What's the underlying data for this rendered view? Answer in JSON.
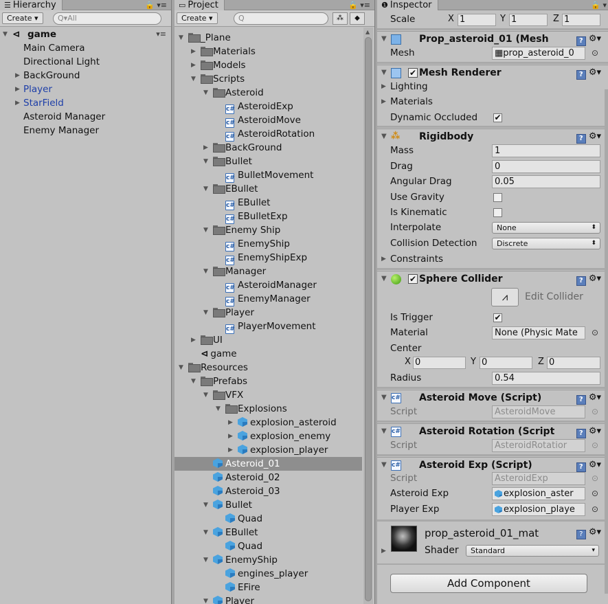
{
  "hierarchy": {
    "tab_label": "Hierarchy",
    "create_label": "Create",
    "search_placeholder": "All",
    "scene_name": "game",
    "items": [
      "Main Camera",
      "Directional Light",
      "BackGround",
      "Player",
      "StarField",
      "Asteroid Manager",
      "Enemy Manager"
    ]
  },
  "project": {
    "tab_label": "Project",
    "create_label": "Create",
    "tree": [
      {
        "label": "_Plane",
        "type": "folder",
        "arrow": "open"
      },
      {
        "label": "Materials",
        "type": "folder",
        "arrow": "closed"
      },
      {
        "label": "Models",
        "type": "folder",
        "arrow": "closed"
      },
      {
        "label": "Scripts",
        "type": "folder",
        "arrow": "open"
      },
      {
        "label": "Asteroid",
        "type": "folder",
        "arrow": "open"
      },
      {
        "label": "AsteroidExp",
        "type": "script"
      },
      {
        "label": "AsteroidMove",
        "type": "script"
      },
      {
        "label": "AsteroidRotation",
        "type": "script"
      },
      {
        "label": "BackGround",
        "type": "folder",
        "arrow": "closed"
      },
      {
        "label": "Bullet",
        "type": "folder",
        "arrow": "open"
      },
      {
        "label": "BulletMovement",
        "type": "script"
      },
      {
        "label": "EBullet",
        "type": "folder",
        "arrow": "open"
      },
      {
        "label": "EBullet",
        "type": "script"
      },
      {
        "label": "EBulletExp",
        "type": "script"
      },
      {
        "label": "Enemy Ship",
        "type": "folder",
        "arrow": "open"
      },
      {
        "label": "EnemyShip",
        "type": "script"
      },
      {
        "label": "EnemyShipExp",
        "type": "script"
      },
      {
        "label": "Manager",
        "type": "folder",
        "arrow": "open"
      },
      {
        "label": "AsteroidManager",
        "type": "script"
      },
      {
        "label": "EnemyManager",
        "type": "script"
      },
      {
        "label": "Player",
        "type": "folder",
        "arrow": "open"
      },
      {
        "label": "PlayerMovement",
        "type": "script"
      },
      {
        "label": "UI",
        "type": "folder",
        "arrow": "closed"
      },
      {
        "label": "game",
        "type": "scene"
      },
      {
        "label": "Resources",
        "type": "folder",
        "arrow": "open"
      },
      {
        "label": "Prefabs",
        "type": "folder",
        "arrow": "open"
      },
      {
        "label": "VFX",
        "type": "folder",
        "arrow": "open"
      },
      {
        "label": "Explosions",
        "type": "folder",
        "arrow": "open"
      },
      {
        "label": "explosion_asteroid",
        "type": "prefab",
        "arrow": "closed"
      },
      {
        "label": "explosion_enemy",
        "type": "prefab",
        "arrow": "closed"
      },
      {
        "label": "explosion_player",
        "type": "prefab",
        "arrow": "closed"
      },
      {
        "label": "Asteroid_01",
        "type": "prefab",
        "selected": true
      },
      {
        "label": "Asteroid_02",
        "type": "prefab"
      },
      {
        "label": "Asteroid_03",
        "type": "prefab"
      },
      {
        "label": "Bullet",
        "type": "prefab",
        "arrow": "open"
      },
      {
        "label": "Quad",
        "type": "prefab"
      },
      {
        "label": "EBullet",
        "type": "prefab",
        "arrow": "open"
      },
      {
        "label": "Quad",
        "type": "prefab"
      },
      {
        "label": "EnemyShip",
        "type": "prefab",
        "arrow": "open"
      },
      {
        "label": "engines_player",
        "type": "prefab"
      },
      {
        "label": "EFire",
        "type": "prefab"
      },
      {
        "label": "Player",
        "type": "prefab",
        "arrow": "open"
      }
    ]
  },
  "inspector": {
    "tab_label": "Inspector",
    "transform": {
      "scale_label": "Scale",
      "x": "1",
      "y": "1",
      "z": "1"
    },
    "mesh_filter": {
      "title": "Prop_asteroid_01 (Mesh",
      "mesh_label": "Mesh",
      "mesh_value": "prop_asteroid_0"
    },
    "mesh_renderer": {
      "title": "Mesh Renderer",
      "lighting": "Lighting",
      "materials": "Materials",
      "dynamic_occluded": "Dynamic Occluded"
    },
    "rigidbody": {
      "title": "Rigidbody",
      "mass_label": "Mass",
      "mass": "1",
      "drag_label": "Drag",
      "drag": "0",
      "angular_drag_label": "Angular Drag",
      "angular_drag": "0.05",
      "use_gravity": "Use Gravity",
      "is_kinematic": "Is Kinematic",
      "interpolate_label": "Interpolate",
      "interpolate": "None",
      "collision_label": "Collision Detection",
      "collision": "Discrete",
      "constraints": "Constraints"
    },
    "sphere_collider": {
      "title": "Sphere Collider",
      "edit_collider": "Edit Collider",
      "is_trigger": "Is Trigger",
      "material_label": "Material",
      "material": "None (Physic Mate",
      "center_label": "Center",
      "cx": "0",
      "cy": "0",
      "cz": "0",
      "radius_label": "Radius",
      "radius": "0.54"
    },
    "asteroid_move": {
      "title": "Asteroid Move (Script)",
      "script_label": "Script",
      "script": "AsteroidMove"
    },
    "asteroid_rotation": {
      "title": "Asteroid Rotation (Script",
      "script_label": "Script",
      "script": "AsteroidRotatior"
    },
    "asteroid_exp": {
      "title": "Asteroid Exp (Script)",
      "script_label": "Script",
      "script": "AsteroidExp",
      "asteroid_exp_label": "Asteroid Exp",
      "asteroid_exp": "explosion_aster",
      "player_exp_label": "Player Exp",
      "player_exp": "explosion_playe"
    },
    "material": {
      "name": "prop_asteroid_01_mat",
      "shader_label": "Shader",
      "shader": "Standard"
    },
    "add_component": "Add Component",
    "axis": {
      "x": "X",
      "y": "Y",
      "z": "Z"
    }
  }
}
